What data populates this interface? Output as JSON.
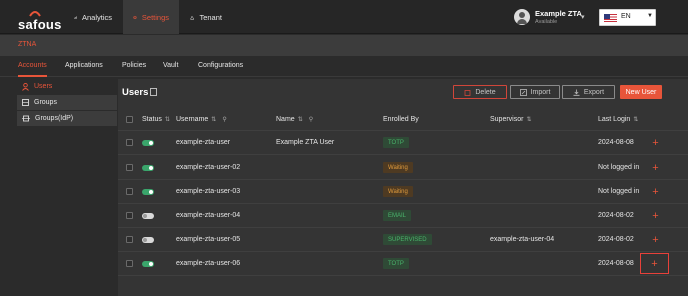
{
  "brand": {
    "name": "safous"
  },
  "nav": {
    "analytics": "Analytics",
    "settings": "Settings",
    "tenant": "Tenant"
  },
  "user": {
    "name": "Example ZTA",
    "status": "Available"
  },
  "language": {
    "selected": "EN"
  },
  "section": {
    "title": "ZTNA"
  },
  "subtabs": [
    "Accounts",
    "Applications",
    "Policies",
    "Vault",
    "Configurations"
  ],
  "sidebar": {
    "items": [
      {
        "label": "Users",
        "icon": "user-icon"
      },
      {
        "label": "Groups",
        "icon": "groups-icon"
      },
      {
        "label": "Groups(IdP)",
        "icon": "idp-groups-icon"
      }
    ]
  },
  "page": {
    "title": "Users"
  },
  "toolbar": {
    "delete": "Delete",
    "import": "Import",
    "export": "Export",
    "new_user": "New User"
  },
  "table": {
    "headers": {
      "status": "Status",
      "username": "Username",
      "name": "Name",
      "enrolled_by": "Enrolled By",
      "supervisor": "Supervisor",
      "last_login": "Last Login"
    },
    "rows": [
      {
        "enabled": true,
        "username": "example-zta-user",
        "name": "Example ZTA User",
        "enrolled_by": "TOTP",
        "enrolled_kind": "totp",
        "supervisor": "",
        "last_login": "2024-08-08"
      },
      {
        "enabled": true,
        "username": "example-zta-user-02",
        "name": "",
        "enrolled_by": "Waiting",
        "enrolled_kind": "waiting",
        "supervisor": "",
        "last_login": "Not logged in"
      },
      {
        "enabled": true,
        "username": "example-zta-user-03",
        "name": "",
        "enrolled_by": "Waiting",
        "enrolled_kind": "waiting",
        "supervisor": "",
        "last_login": "Not logged in"
      },
      {
        "enabled": false,
        "username": "example-zta-user-04",
        "name": "",
        "enrolled_by": "EMAIL",
        "enrolled_kind": "email",
        "supervisor": "",
        "last_login": "2024-08-02"
      },
      {
        "enabled": false,
        "username": "example-zta-user-05",
        "name": "",
        "enrolled_by": "SUPERVISED",
        "enrolled_kind": "supervised",
        "supervisor": "example-zta-user-04",
        "last_login": "2024-08-02"
      },
      {
        "enabled": true,
        "username": "example-zta-user-06",
        "name": "",
        "enrolled_by": "TOTP",
        "enrolled_kind": "totp",
        "supervisor": "",
        "last_login": "2024-08-08"
      }
    ]
  },
  "colors": {
    "accent": "#e8553a",
    "toggle_on": "#3aa56b",
    "tag_green": "#49b46b",
    "tag_orange": "#e09b3c"
  }
}
